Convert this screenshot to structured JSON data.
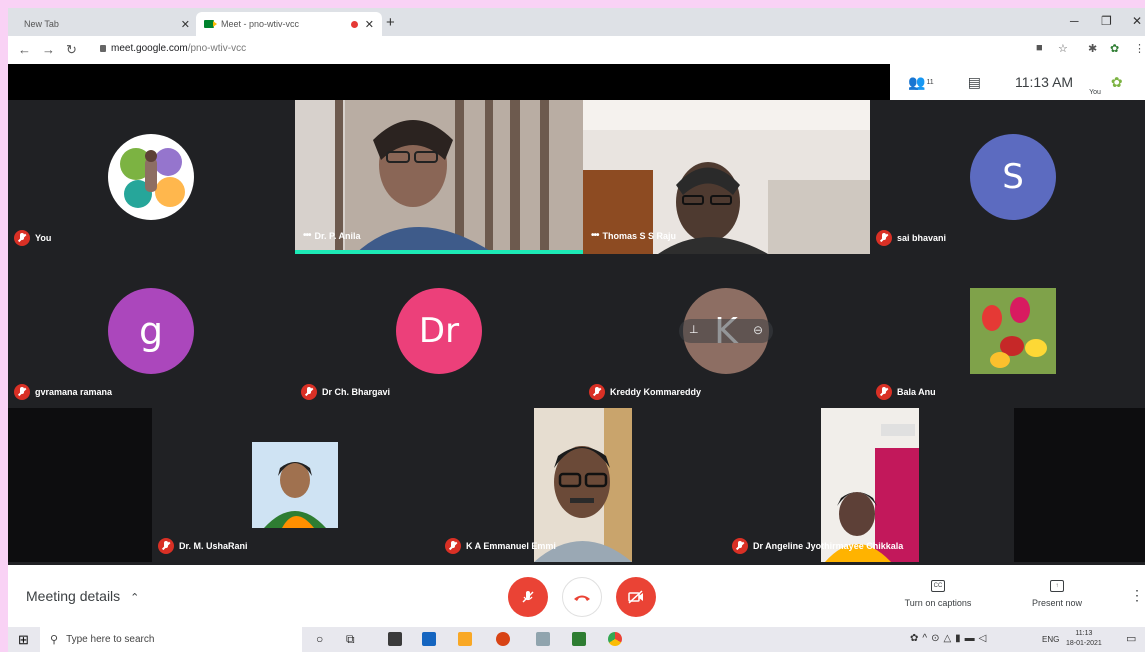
{
  "browser": {
    "tabs": [
      {
        "title": "New Tab"
      },
      {
        "title": "Meet - pno-wtiv-vcc"
      }
    ],
    "url_host": "meet.google.com",
    "url_path": "/pno-wtiv-vcc"
  },
  "meet": {
    "participant_count": "11",
    "clock": "11:13 AM",
    "self_label": "You",
    "participants": [
      {
        "name": "You",
        "avatar": "image",
        "muted": true
      },
      {
        "name": "Dr. P. Anila",
        "avatar": "video",
        "muted": false
      },
      {
        "name": "Thomas S S Raju",
        "avatar": "video",
        "muted": false
      },
      {
        "name": "sai bhavani",
        "avatar": "S",
        "avatar_color": "#5c6bc0",
        "muted": true
      },
      {
        "name": "gvramana ramana",
        "avatar": "g",
        "avatar_color": "#ab47bc",
        "muted": true
      },
      {
        "name": "Dr Ch. Bhargavi",
        "avatar": "Dr",
        "avatar_color": "#ec407a",
        "muted": true
      },
      {
        "name": "Kreddy Kommareddy",
        "avatar": "K",
        "avatar_color": "#8d6e63",
        "muted": true
      },
      {
        "name": "Bala Anu",
        "avatar": "image",
        "muted": true
      },
      {
        "name": "Dr. M. UshaRani",
        "avatar": "image",
        "muted": true
      },
      {
        "name": "K A Emmanuel Emmi",
        "avatar": "video",
        "muted": true
      },
      {
        "name": "Dr Angeline Jyothirmayee Chikkala",
        "avatar": "video",
        "muted": true
      }
    ],
    "meeting_details_label": "Meeting details",
    "captions_label": "Turn on captions",
    "present_label": "Present now"
  },
  "taskbar": {
    "search_placeholder": "Type here to search",
    "language": "ENG",
    "time": "11:13",
    "date": "18-01-2021"
  },
  "colors": {
    "accent_red": "#ea4335",
    "stage_bg": "#202124",
    "frame_pink": "#f9d2f5"
  }
}
